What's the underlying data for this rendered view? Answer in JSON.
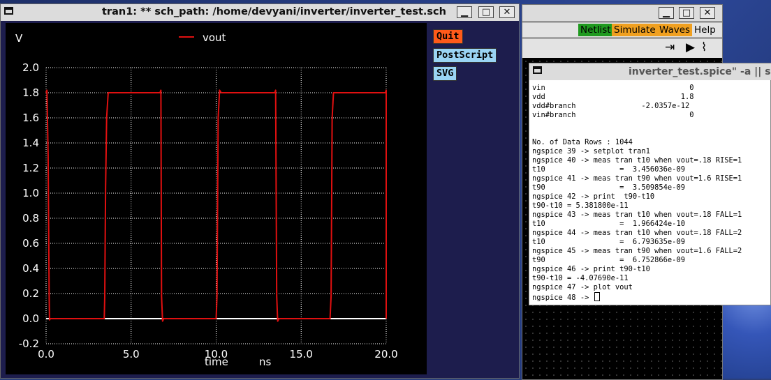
{
  "plot_window": {
    "title": "tran1: ** sch_path: /home/devyani/inverter/inverter_test.sch",
    "buttons": {
      "quit": "Quit",
      "postscript": "PostScript",
      "svg": "SVG"
    }
  },
  "xschem_window": {
    "menu": {
      "netlist": "Netlist",
      "simulate": "Simulate",
      "waves": "Waves",
      "help": "Help"
    },
    "colors": {
      "netlist_bg": "#1f9a1f",
      "simulate_bg": "#f0a020",
      "waves_bg": "#f0a020"
    }
  },
  "terminal_window": {
    "title": "inverter_test.spice\" -a || sh",
    "lines": [
      "vin                                 0",
      "vdd                               1.8",
      "vdd#branch               -2.0357e-12",
      "vin#branch                          0",
      "",
      "",
      "No. of Data Rows : 1044",
      "ngspice 39 -> setplot tran1",
      "ngspice 40 -> meas tran t10 when vout=.18 RISE=1",
      "t10                 =  3.456036e-09",
      "ngspice 41 -> meas tran t90 when vout=1.6 RISE=1",
      "t90                 =  3.509854e-09",
      "ngspice 42 -> print  t90-t10",
      "t90-t10 = 5.381800e-11",
      "ngspice 43 -> meas tran t10 when vout=.18 FALL=1",
      "t10                 =  1.966424e-10",
      "ngspice 44 -> meas tran t10 when vout=.18 FALL=2",
      "t10                 =  6.793635e-09",
      "ngspice 45 -> meas tran t90 when vout=1.6 FALL=2",
      "t90                 =  6.752866e-09",
      "ngspice 46 -> print t90-t10",
      "t90-t10 = -4.07690e-11",
      "ngspice 47 -> plot vout",
      "ngspice 48 -> "
    ]
  },
  "chart_data": {
    "type": "line",
    "title": "",
    "xlabel": "time",
    "xunit": "ns",
    "ylabel": "V",
    "xlim": [
      0,
      20
    ],
    "ylim": [
      -0.2,
      2.0
    ],
    "x_ticks": [
      "0.0",
      "5.0",
      "10.0",
      "15.0",
      "20.0"
    ],
    "y_ticks": [
      "2.0",
      "1.8",
      "1.6",
      "1.4",
      "1.2",
      "1.0",
      "0.8",
      "0.6",
      "0.4",
      "0.2",
      "0.0",
      "-0.2"
    ],
    "grid": true,
    "legend": "top-center",
    "colors": {
      "vout": "#e01010",
      "zero_line": "#ffffff",
      "grid": "#ffffff",
      "axis_text": "#ffffff"
    },
    "series": [
      {
        "name": "vout",
        "x": [
          0.0,
          0.05,
          0.12,
          0.18,
          0.2,
          0.25,
          3.42,
          3.45,
          3.5,
          3.56,
          3.65,
          6.7,
          6.75,
          6.79,
          6.85,
          6.92,
          10.0,
          10.05,
          10.12,
          10.2,
          10.3,
          13.45,
          13.5,
          13.56,
          13.62,
          13.7,
          16.7,
          16.76,
          16.82,
          16.9,
          19.95,
          20.0,
          20.0
        ],
        "y": [
          1.8,
          1.82,
          1.3,
          0.18,
          -0.01,
          0.0,
          0.0,
          0.18,
          1.05,
          1.6,
          1.8,
          1.8,
          1.82,
          0.18,
          -0.02,
          0.0,
          0.0,
          0.18,
          1.6,
          1.82,
          1.8,
          1.8,
          1.82,
          0.18,
          -0.02,
          0.0,
          0.0,
          0.18,
          1.6,
          1.8,
          1.8,
          1.82,
          0.0
        ]
      }
    ]
  }
}
